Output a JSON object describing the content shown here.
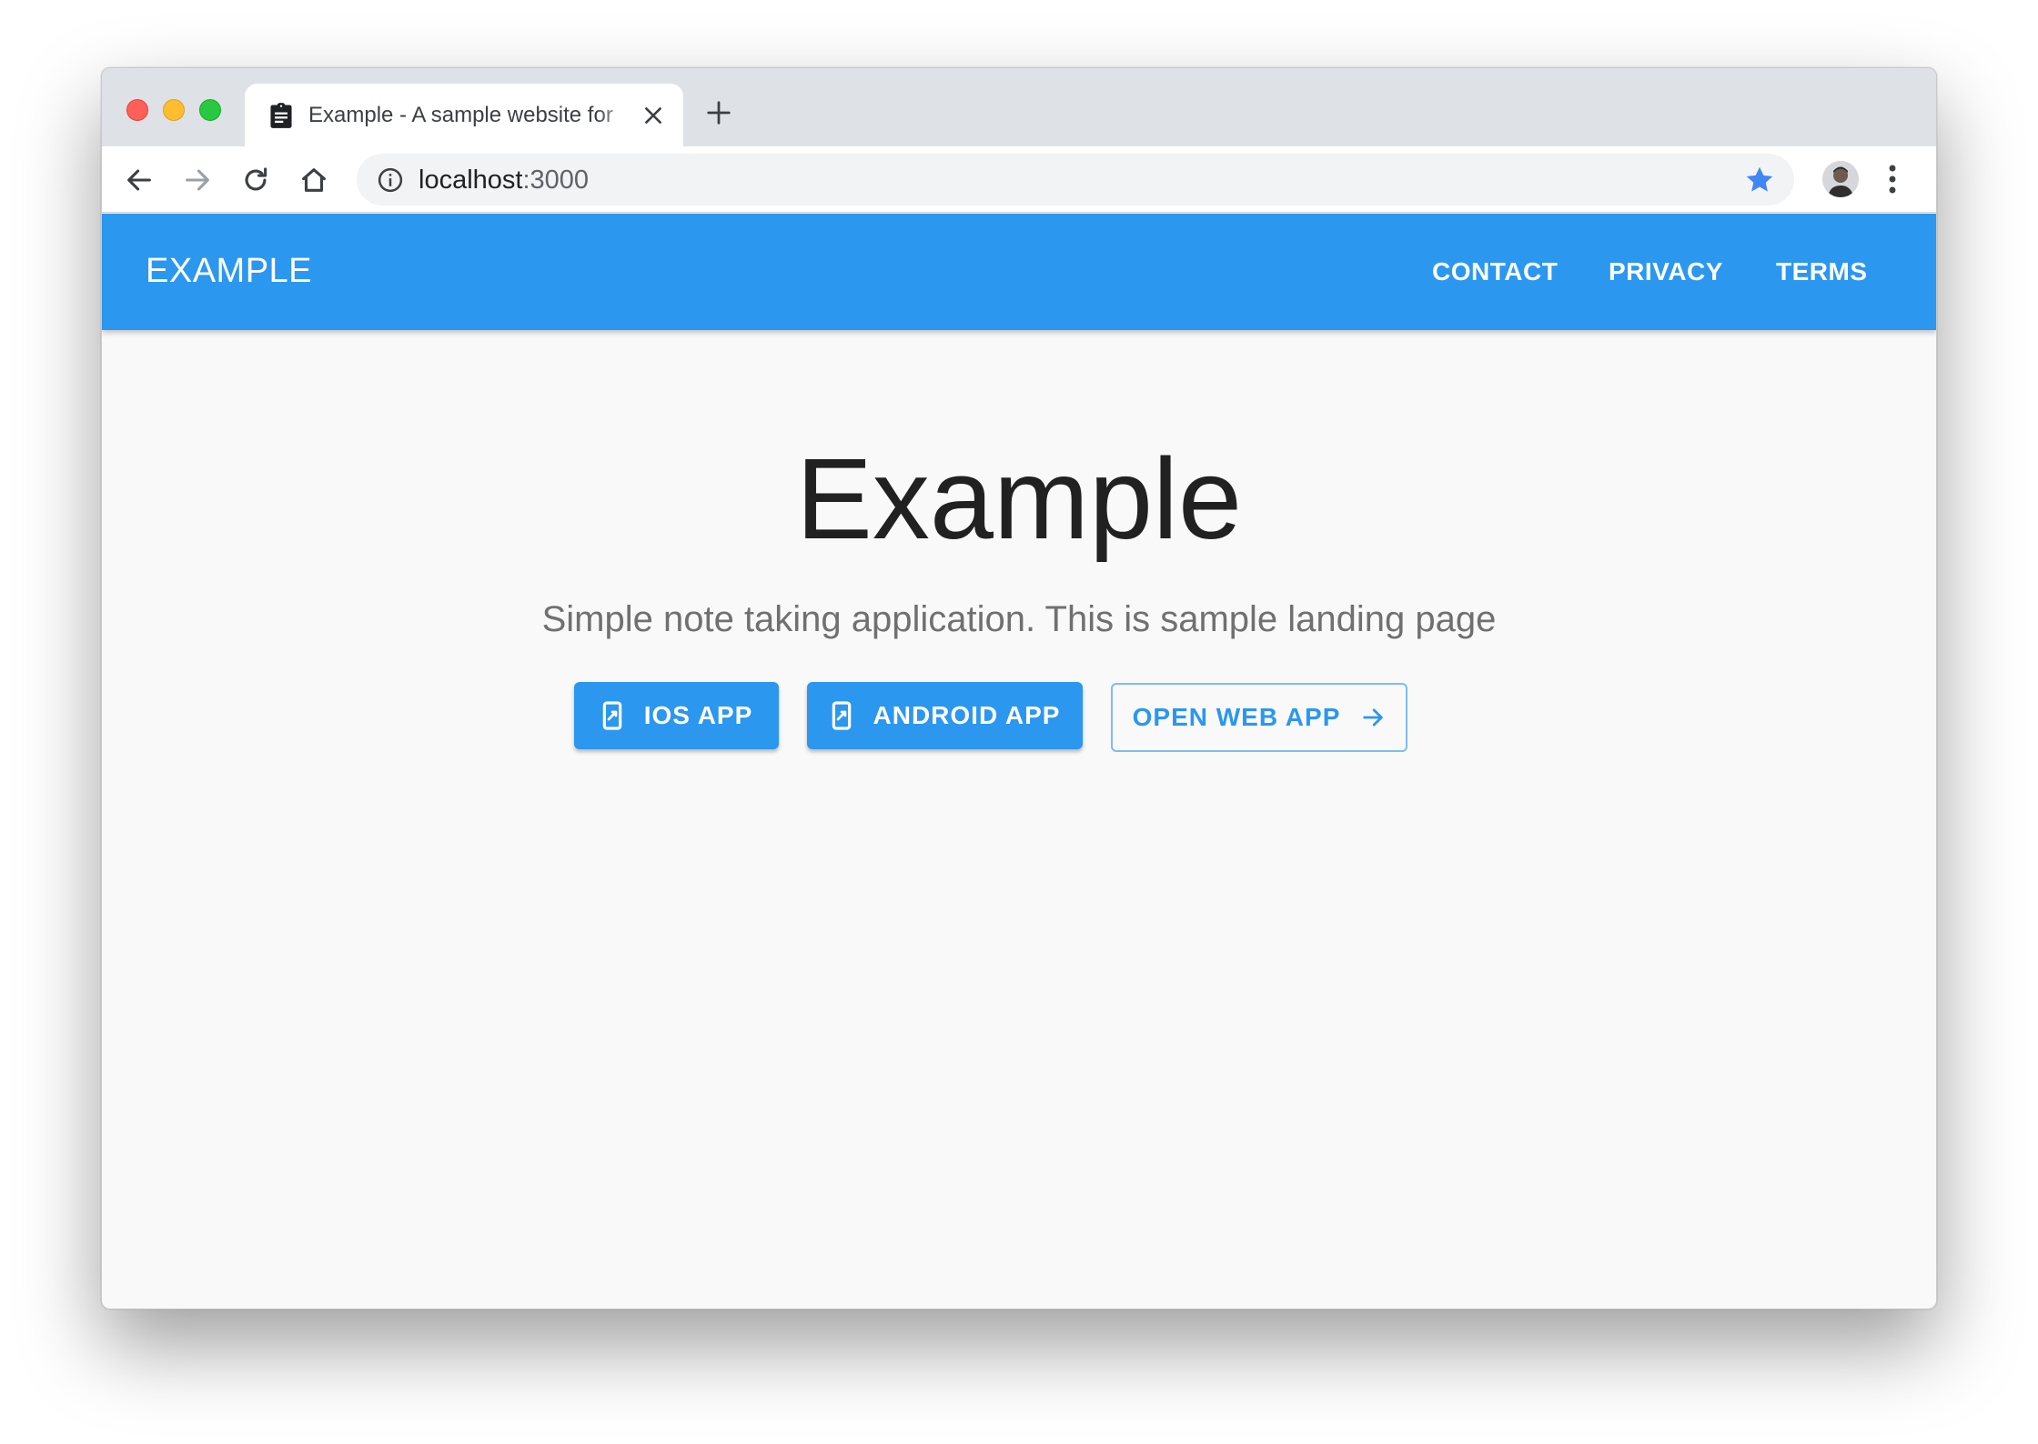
{
  "browser": {
    "tab_title": "Example - A sample website for",
    "url_host": "localhost",
    "url_port": ":3000"
  },
  "appbar": {
    "brand": "EXAMPLE",
    "nav": [
      "CONTACT",
      "PRIVACY",
      "TERMS"
    ]
  },
  "hero": {
    "title": "Example",
    "subtitle": "Simple note taking application. This is sample landing page",
    "buttons": {
      "ios": "IOS APP",
      "android": "ANDROID APP",
      "web": "OPEN WEB APP"
    }
  },
  "colors": {
    "primary": "#2b97ef",
    "tabstrip": "#dee1e6",
    "star": "#4285f4",
    "page_background": "#f9f9f9"
  },
  "icons": {
    "tab_favicon": "clipboard-icon",
    "button_phone": "phonelink-icon",
    "button_arrow": "arrow-right-icon"
  }
}
